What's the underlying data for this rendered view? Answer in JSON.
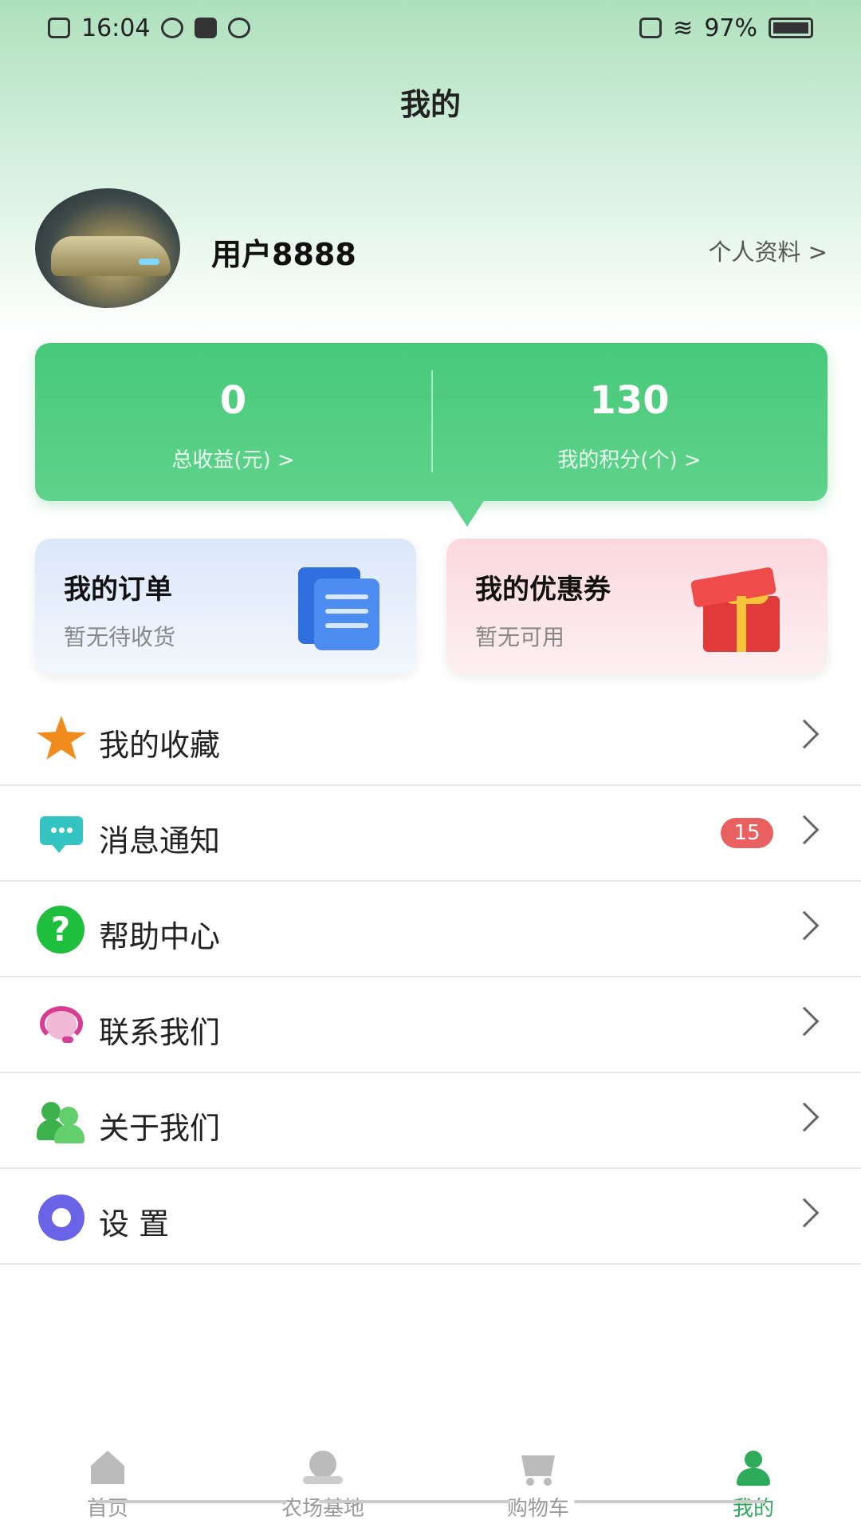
{
  "status_bar": {
    "time": "16:04",
    "battery": "97%"
  },
  "header": {
    "title": "我的"
  },
  "profile": {
    "username": "用户8888",
    "profile_link": "个人资料 >"
  },
  "stats": [
    {
      "value": "0",
      "label": "总收益(元) >"
    },
    {
      "value": "130",
      "label": "我的积分(个) >"
    }
  ],
  "quick_cards": {
    "order": {
      "title": "我的订单",
      "subtitle": "暂无待收货",
      "icon": "order-list-icon"
    },
    "coupon": {
      "title": "我的优惠券",
      "subtitle": "暂无可用",
      "icon": "gift-box-icon"
    }
  },
  "menu": [
    {
      "label": "我的收藏",
      "icon": "star-icon",
      "icon_color": "#f08c1e"
    },
    {
      "label": "消息通知",
      "icon": "message-icon",
      "icon_color": "#33c3c0",
      "badge": "15"
    },
    {
      "label": "帮助中心",
      "icon": "help-icon",
      "icon_color": "#1fbf3e"
    },
    {
      "label": "联系我们",
      "icon": "headset-icon",
      "icon_color": "#d63d93"
    },
    {
      "label": "关于我们",
      "icon": "users-icon",
      "icon_color": "#3db24c"
    },
    {
      "label": "设 置",
      "icon": "gear-icon",
      "icon_color": "#6a63e8"
    }
  ],
  "bottom_nav": [
    {
      "label": "首页",
      "icon": "home-icon"
    },
    {
      "label": "农场基地",
      "icon": "farm-icon"
    },
    {
      "label": "购物车",
      "icon": "cart-icon"
    },
    {
      "label": "我的",
      "icon": "user-icon",
      "active": true
    }
  ],
  "colors": {
    "accent_green": "#48c97a",
    "active_tab": "#2daa5a",
    "badge_red": "#e86060"
  }
}
